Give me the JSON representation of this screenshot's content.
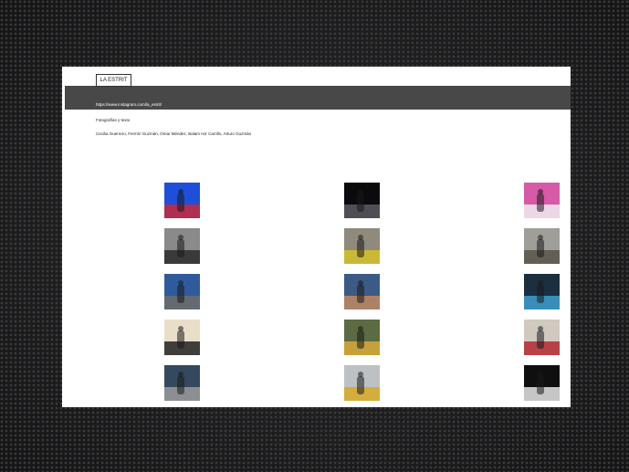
{
  "header": {
    "title": "LA ESTRIT",
    "link": "https://www.instagram.com/la_estrit/",
    "subtitle": "Fotografías y  texto",
    "authors": "Cecilia Guerrero, Fermín Guzmán, Omar Méndez, Balam Ha' Carrillo, Arturo Guzmán"
  },
  "gallery": {
    "thumbnails": [
      {
        "label": "street-sign-photo",
        "colors": [
          "#1f4fd8",
          "#c9283a"
        ]
      },
      {
        "label": "dark-interior-photo",
        "colors": [
          "#0b0b0e",
          "#5a5a60"
        ]
      },
      {
        "label": "pink-wall-photo",
        "colors": [
          "#d65aa6",
          "#eeeeee"
        ]
      },
      {
        "label": "bw-figure-photo",
        "colors": [
          "#8a8a8a",
          "#2b2b2b"
        ]
      },
      {
        "label": "street-figures-photo",
        "colors": [
          "#8f8a7c",
          "#d6c12a"
        ]
      },
      {
        "label": "plaza-photo",
        "colors": [
          "#9f9e98",
          "#58534a"
        ]
      },
      {
        "label": "seated-man-photo",
        "colors": [
          "#2f5b9a",
          "#6d6d68"
        ]
      },
      {
        "label": "hat-portrait-photo",
        "colors": [
          "#3b5a86",
          "#c08a62"
        ]
      },
      {
        "label": "blue-figure-photo",
        "colors": [
          "#1c2f3e",
          "#3d9fcf"
        ]
      },
      {
        "label": "shadow-wall-photo",
        "colors": [
          "#e9dfc8",
          "#222222"
        ]
      },
      {
        "label": "street-stall-photo",
        "colors": [
          "#5c6b43",
          "#d8a93a"
        ]
      },
      {
        "label": "red-dress-photo",
        "colors": [
          "#cfc9c0",
          "#b12a32"
        ]
      },
      {
        "label": "crowd-photo",
        "colors": [
          "#34495e",
          "#9b9b9b"
        ]
      },
      {
        "label": "yellow-street-photo",
        "colors": [
          "#bdc1c4",
          "#d8a924"
        ]
      },
      {
        "label": "bw-church-photo",
        "colors": [
          "#0f0f0f",
          "#e6e6e6"
        ]
      }
    ]
  }
}
